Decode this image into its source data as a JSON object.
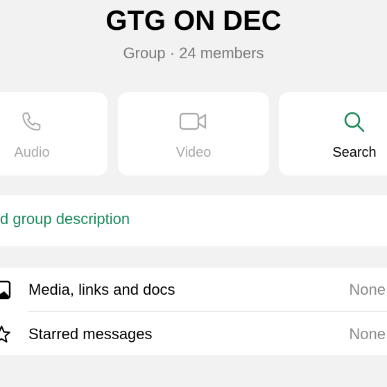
{
  "header": {
    "title": "GTG ON DEC",
    "subtitle": "Group · 24 members"
  },
  "actions": [
    {
      "label": "Audio",
      "icon": "phone-icon",
      "enabled": false
    },
    {
      "label": "Video",
      "icon": "video-camera-icon",
      "enabled": false
    },
    {
      "label": "Search",
      "icon": "search-icon",
      "enabled": true
    }
  ],
  "description": {
    "label": "d group description"
  },
  "list": [
    {
      "label": "Media, links and docs",
      "value": "None",
      "icon": "image-icon"
    },
    {
      "label": "Starred messages",
      "value": "None",
      "icon": "star-icon"
    }
  ],
  "colors": {
    "accent": "#1a8a5a",
    "background": "#f2f2f2",
    "disabled": "#a8a8a8"
  }
}
